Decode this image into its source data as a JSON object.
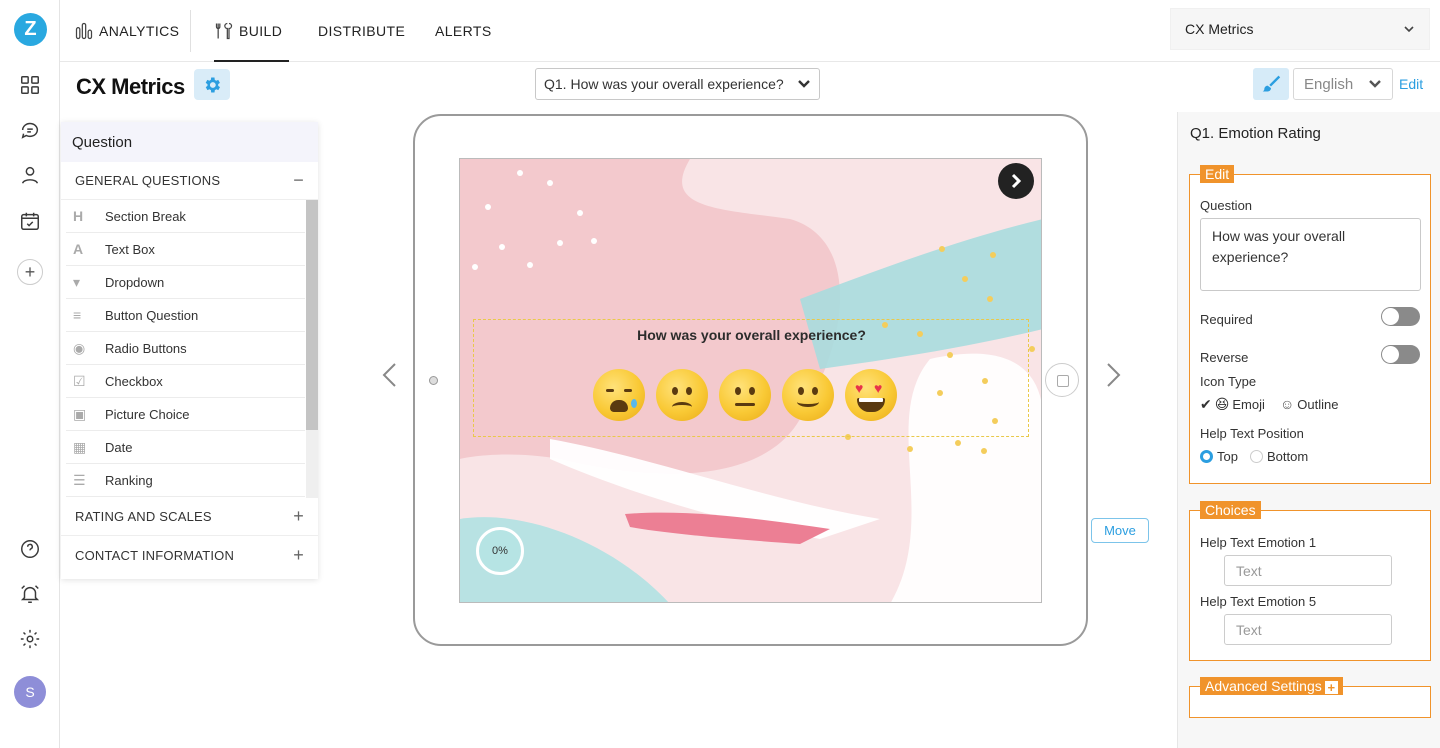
{
  "nav": {
    "analytics": "ANALYTICS",
    "build": "BUILD",
    "distribute": "DISTRIBUTE",
    "alerts": "ALERTS",
    "survey_select": "CX Metrics"
  },
  "rail": {
    "avatar": "S"
  },
  "header": {
    "title": "CX Metrics",
    "question_select": "Q1. How was your overall experience?",
    "language": "English",
    "edit_label": "Edit"
  },
  "library": {
    "title": "Question",
    "sections": [
      {
        "label": "GENERAL QUESTIONS",
        "toggle": "−"
      },
      {
        "label": "RATING AND SCALES",
        "toggle": "+"
      },
      {
        "label": "CONTACT INFORMATION",
        "toggle": "+"
      }
    ],
    "items": [
      {
        "icon": "H",
        "label": "Section Break"
      },
      {
        "icon": "A",
        "label": "Text Box"
      },
      {
        "icon": "▾",
        "label": "Dropdown"
      },
      {
        "icon": "≡",
        "label": "Button Question"
      },
      {
        "icon": "◉",
        "label": "Radio Buttons"
      },
      {
        "icon": "☑",
        "label": "Checkbox"
      },
      {
        "icon": "▣",
        "label": "Picture Choice"
      },
      {
        "icon": "▦",
        "label": "Date"
      },
      {
        "icon": "☰",
        "label": "Ranking"
      }
    ]
  },
  "preview": {
    "question": "How was your overall experience?",
    "progress": "0%",
    "move_label": "Move"
  },
  "panel": {
    "title": "Q1. Emotion Rating",
    "edit_legend": "Edit",
    "question_label": "Question",
    "question_value": "How was your overall experience?",
    "required_label": "Required",
    "reverse_label": "Reverse",
    "icon_type_label": "Icon Type",
    "icon_emoji": "Emoji",
    "icon_outline": "Outline",
    "help_pos_label": "Help Text Position",
    "pos_top": "Top",
    "pos_bottom": "Bottom",
    "choices_legend": "Choices",
    "help1_label": "Help Text Emotion 1",
    "help5_label": "Help Text Emotion 5",
    "text_placeholder": "Text",
    "advanced_legend": "Advanced Settings"
  }
}
